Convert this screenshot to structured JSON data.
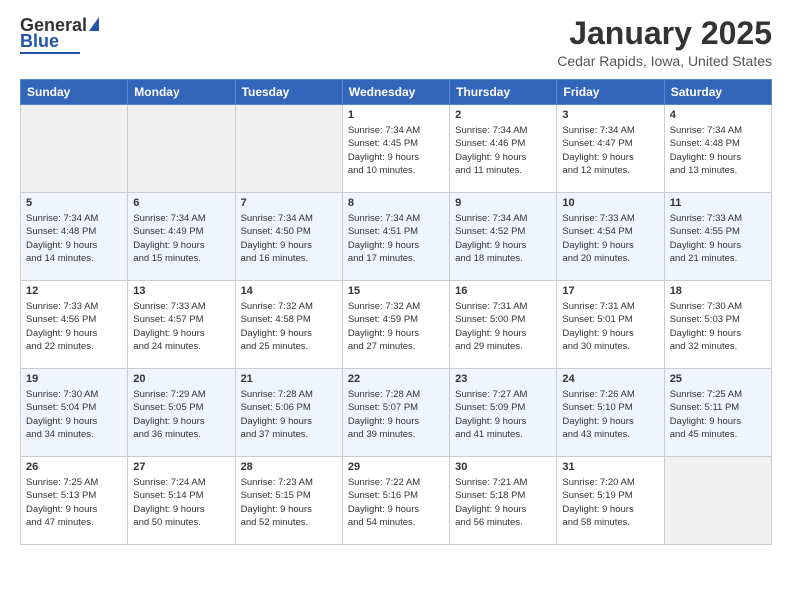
{
  "header": {
    "logo_general": "General",
    "logo_blue": "Blue",
    "month": "January 2025",
    "location": "Cedar Rapids, Iowa, United States"
  },
  "weekdays": [
    "Sunday",
    "Monday",
    "Tuesday",
    "Wednesday",
    "Thursday",
    "Friday",
    "Saturday"
  ],
  "weeks": [
    [
      {
        "day": "",
        "info": ""
      },
      {
        "day": "",
        "info": ""
      },
      {
        "day": "",
        "info": ""
      },
      {
        "day": "1",
        "info": "Sunrise: 7:34 AM\nSunset: 4:45 PM\nDaylight: 9 hours\nand 10 minutes."
      },
      {
        "day": "2",
        "info": "Sunrise: 7:34 AM\nSunset: 4:46 PM\nDaylight: 9 hours\nand 11 minutes."
      },
      {
        "day": "3",
        "info": "Sunrise: 7:34 AM\nSunset: 4:47 PM\nDaylight: 9 hours\nand 12 minutes."
      },
      {
        "day": "4",
        "info": "Sunrise: 7:34 AM\nSunset: 4:48 PM\nDaylight: 9 hours\nand 13 minutes."
      }
    ],
    [
      {
        "day": "5",
        "info": "Sunrise: 7:34 AM\nSunset: 4:48 PM\nDaylight: 9 hours\nand 14 minutes."
      },
      {
        "day": "6",
        "info": "Sunrise: 7:34 AM\nSunset: 4:49 PM\nDaylight: 9 hours\nand 15 minutes."
      },
      {
        "day": "7",
        "info": "Sunrise: 7:34 AM\nSunset: 4:50 PM\nDaylight: 9 hours\nand 16 minutes."
      },
      {
        "day": "8",
        "info": "Sunrise: 7:34 AM\nSunset: 4:51 PM\nDaylight: 9 hours\nand 17 minutes."
      },
      {
        "day": "9",
        "info": "Sunrise: 7:34 AM\nSunset: 4:52 PM\nDaylight: 9 hours\nand 18 minutes."
      },
      {
        "day": "10",
        "info": "Sunrise: 7:33 AM\nSunset: 4:54 PM\nDaylight: 9 hours\nand 20 minutes."
      },
      {
        "day": "11",
        "info": "Sunrise: 7:33 AM\nSunset: 4:55 PM\nDaylight: 9 hours\nand 21 minutes."
      }
    ],
    [
      {
        "day": "12",
        "info": "Sunrise: 7:33 AM\nSunset: 4:56 PM\nDaylight: 9 hours\nand 22 minutes."
      },
      {
        "day": "13",
        "info": "Sunrise: 7:33 AM\nSunset: 4:57 PM\nDaylight: 9 hours\nand 24 minutes."
      },
      {
        "day": "14",
        "info": "Sunrise: 7:32 AM\nSunset: 4:58 PM\nDaylight: 9 hours\nand 25 minutes."
      },
      {
        "day": "15",
        "info": "Sunrise: 7:32 AM\nSunset: 4:59 PM\nDaylight: 9 hours\nand 27 minutes."
      },
      {
        "day": "16",
        "info": "Sunrise: 7:31 AM\nSunset: 5:00 PM\nDaylight: 9 hours\nand 29 minutes."
      },
      {
        "day": "17",
        "info": "Sunrise: 7:31 AM\nSunset: 5:01 PM\nDaylight: 9 hours\nand 30 minutes."
      },
      {
        "day": "18",
        "info": "Sunrise: 7:30 AM\nSunset: 5:03 PM\nDaylight: 9 hours\nand 32 minutes."
      }
    ],
    [
      {
        "day": "19",
        "info": "Sunrise: 7:30 AM\nSunset: 5:04 PM\nDaylight: 9 hours\nand 34 minutes."
      },
      {
        "day": "20",
        "info": "Sunrise: 7:29 AM\nSunset: 5:05 PM\nDaylight: 9 hours\nand 36 minutes."
      },
      {
        "day": "21",
        "info": "Sunrise: 7:28 AM\nSunset: 5:06 PM\nDaylight: 9 hours\nand 37 minutes."
      },
      {
        "day": "22",
        "info": "Sunrise: 7:28 AM\nSunset: 5:07 PM\nDaylight: 9 hours\nand 39 minutes."
      },
      {
        "day": "23",
        "info": "Sunrise: 7:27 AM\nSunset: 5:09 PM\nDaylight: 9 hours\nand 41 minutes."
      },
      {
        "day": "24",
        "info": "Sunrise: 7:26 AM\nSunset: 5:10 PM\nDaylight: 9 hours\nand 43 minutes."
      },
      {
        "day": "25",
        "info": "Sunrise: 7:25 AM\nSunset: 5:11 PM\nDaylight: 9 hours\nand 45 minutes."
      }
    ],
    [
      {
        "day": "26",
        "info": "Sunrise: 7:25 AM\nSunset: 5:13 PM\nDaylight: 9 hours\nand 47 minutes."
      },
      {
        "day": "27",
        "info": "Sunrise: 7:24 AM\nSunset: 5:14 PM\nDaylight: 9 hours\nand 50 minutes."
      },
      {
        "day": "28",
        "info": "Sunrise: 7:23 AM\nSunset: 5:15 PM\nDaylight: 9 hours\nand 52 minutes."
      },
      {
        "day": "29",
        "info": "Sunrise: 7:22 AM\nSunset: 5:16 PM\nDaylight: 9 hours\nand 54 minutes."
      },
      {
        "day": "30",
        "info": "Sunrise: 7:21 AM\nSunset: 5:18 PM\nDaylight: 9 hours\nand 56 minutes."
      },
      {
        "day": "31",
        "info": "Sunrise: 7:20 AM\nSunset: 5:19 PM\nDaylight: 9 hours\nand 58 minutes."
      },
      {
        "day": "",
        "info": ""
      }
    ]
  ]
}
